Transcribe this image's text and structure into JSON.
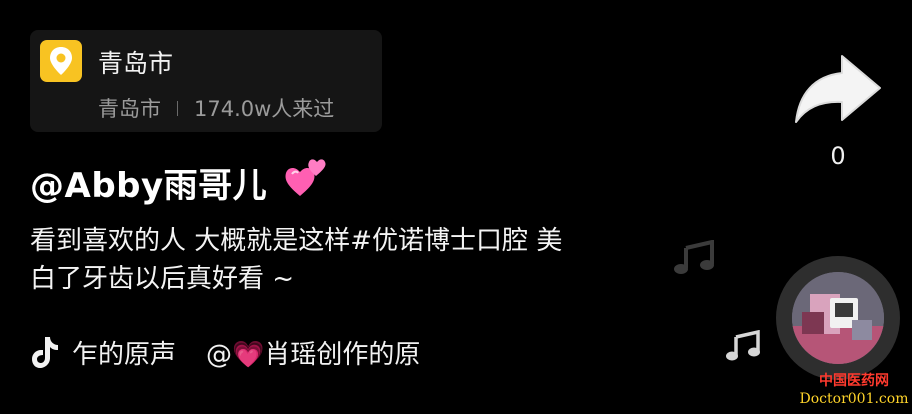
{
  "location": {
    "title": "青岛市",
    "city": "青岛市",
    "visits": "174.0w人来过",
    "icon": "location-pin-icon",
    "accent": "#f8c322"
  },
  "share": {
    "icon": "share-arrow-icon",
    "count": "0"
  },
  "author": {
    "handle": "@Abby雨哥儿",
    "emoji": "two-hearts-icon"
  },
  "caption": {
    "line1": "看到喜欢的人 大概就是这样#优诺博士口腔 美",
    "line2": "白了牙齿以后真好看 ~"
  },
  "music": {
    "icon": "tiktok-note-icon",
    "text_part1": "乍的原声",
    "text_part2": "@💗肖瑶创作的原"
  },
  "disc": {
    "icon": "music-disc-avatar"
  },
  "watermark": {
    "cn": "中国医药网",
    "en": "Doctor001.com"
  }
}
